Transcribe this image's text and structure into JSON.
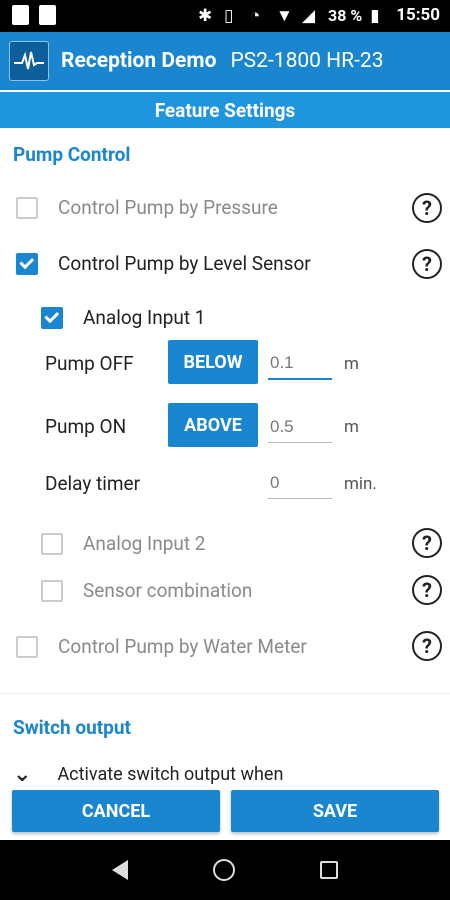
{
  "status_bar": {
    "battery": "38 %",
    "time": "15:50"
  },
  "header": {
    "app_title": "Reception Demo",
    "device": "PS2-1800 HR-23",
    "subtitle": "Feature Settings"
  },
  "pump_control": {
    "title": "Pump Control",
    "by_pressure": {
      "label": "Control Pump by Pressure",
      "checked": false
    },
    "by_level": {
      "label": "Control Pump by Level Sensor",
      "checked": true
    },
    "analog_input_1": {
      "label": "Analog Input 1",
      "checked": true
    },
    "pump_off": {
      "label": "Pump OFF",
      "mode": "BELOW",
      "value": "0.1",
      "unit": "m"
    },
    "pump_on": {
      "label": "Pump ON",
      "mode": "ABOVE",
      "value": "0.5",
      "unit": "m"
    },
    "delay": {
      "label": "Delay timer",
      "value": "0",
      "unit": "min."
    },
    "analog_input_2": {
      "label": "Analog Input 2",
      "checked": false
    },
    "sensor_combination": {
      "label": "Sensor combination",
      "checked": false
    },
    "by_water_meter": {
      "label": "Control Pump by Water Meter",
      "checked": false
    },
    "help_symbol": "?"
  },
  "switch_output": {
    "title": "Switch output",
    "partial_row": "Activate switch output when"
  },
  "footer": {
    "cancel": "CANCEL",
    "save": "SAVE"
  }
}
